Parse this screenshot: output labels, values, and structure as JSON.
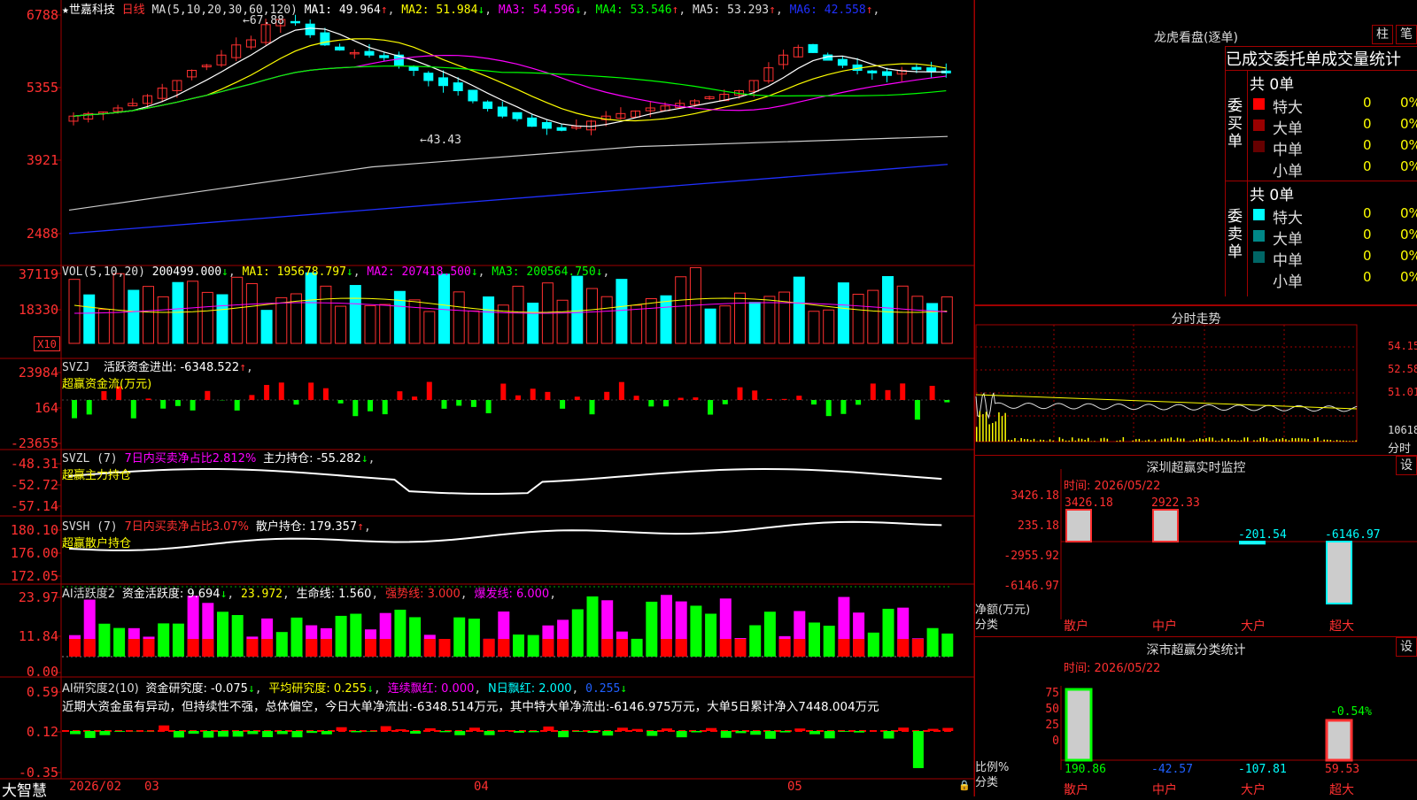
{
  "stock": {
    "name": "世嘉科技",
    "period": "日线",
    "star": "★"
  },
  "main": {
    "ma_label": "MA(5,10,20,30,60,120)",
    "ma": [
      {
        "label": "MA1: 49.964",
        "arrow": "↑",
        "color": "#ffffff"
      },
      {
        "label": "MA2: 51.984",
        "arrow": "↓",
        "color": "#ffff00"
      },
      {
        "label": "MA3: 54.596",
        "arrow": "↓",
        "color": "#ff00ff"
      },
      {
        "label": "MA4: 53.546",
        "arrow": "↑",
        "color": "#00ff00"
      },
      {
        "label": "MA5: 53.293",
        "arrow": "↑",
        "color": "#dddddd"
      },
      {
        "label": "MA6: 42.558",
        "arrow": "↑",
        "color": "#2030ff"
      }
    ],
    "yticks": [
      "6788",
      "5355",
      "3921",
      "2488"
    ],
    "high_marker": "67.88",
    "low_marker": "43.43"
  },
  "vol": {
    "title": "VOL(5,10,20)",
    "value": "200499.000",
    "ma": [
      {
        "label": "MA1: 195678.797",
        "color": "#ffff00"
      },
      {
        "label": "MA2: 207418.500",
        "color": "#ff00ff"
      },
      {
        "label": "MA3: 200564.750",
        "color": "#00ff00"
      }
    ],
    "yticks": [
      "37119",
      "18330"
    ],
    "unit": "X10"
  },
  "svzj": {
    "title": "SVZJ",
    "text": "活跃资金进出: -6348.522",
    "subtitle": "超赢资金流(万元)",
    "yticks": [
      "23984",
      "164",
      "-23655"
    ]
  },
  "svzl": {
    "title": "SVZL (7)",
    "text1": "7日内买卖净占比2.812%",
    "text2": "主力持仓: -55.282",
    "subtitle": "超赢主力持仓",
    "yticks": [
      "-48.31",
      "-52.72",
      "-57.14"
    ]
  },
  "svsh": {
    "title": "SVSH (7)",
    "text1": "7日内买卖净占比3.07%",
    "text2": "散户持仓: 179.357",
    "subtitle": "超赢散户持仓",
    "yticks": [
      "180.10",
      "176.00",
      "172.05"
    ]
  },
  "ai1": {
    "title": "AI活跃度2",
    "t1": "资金活跃度: 9.694",
    "t2": "23.972",
    "t3": "生命线: 1.560",
    "t4": "强势线: 3.000",
    "t5": "爆发线: 6.000",
    "yticks": [
      "23.97",
      "11.84",
      "0.00"
    ]
  },
  "ai2": {
    "title": "AI研究度2(10)",
    "t1": "资金研究度: -0.075",
    "t2": "平均研究度: 0.255",
    "t3": "连续飘红: 0.000",
    "t4": "N日飘红: 2.000",
    "t5": "0.255",
    "comment": "近期大资金虽有异动，但持续性不强，总体偏空，今日大单净流出:-6348.514万元，其中特大单净流出:-6146.975万元，大单5日累计净入7448.004万元",
    "yticks": [
      "0.59",
      "0.12",
      "-0.35"
    ]
  },
  "xaxis": {
    "brand": "大智慧",
    "labels": [
      "2026/02",
      "03",
      "04",
      "05"
    ]
  },
  "lhb": {
    "title": "龙虎看盘(逐单)",
    "btn1": "柱",
    "btn2": "笔",
    "header": "已成交委托单成交量统计",
    "buy": {
      "side": "委买单",
      "total": "共 0单",
      "rows": [
        {
          "label": "特大",
          "v1": "0",
          "v2": "0%",
          "color": "#ff0000"
        },
        {
          "label": "大单",
          "v1": "0",
          "v2": "0%",
          "color": "#990000"
        },
        {
          "label": "中单",
          "v1": "0",
          "v2": "0%",
          "color": "#660000"
        },
        {
          "label": "小单",
          "v1": "0",
          "v2": "0%",
          "color": "#000000"
        }
      ]
    },
    "sell": {
      "side": "委卖单",
      "total": "共 0单",
      "rows": [
        {
          "label": "特大",
          "v1": "0",
          "v2": "0%",
          "color": "#00ffff"
        },
        {
          "label": "大单",
          "v1": "0",
          "v2": "0%",
          "color": "#008888"
        },
        {
          "label": "中单",
          "v1": "0",
          "v2": "0%",
          "color": "#006666"
        },
        {
          "label": "小单",
          "v1": "0",
          "v2": "0%",
          "color": "#000000"
        }
      ]
    }
  },
  "fs": {
    "title": "分时走势",
    "yticks": [
      "54.15",
      "52.58",
      "51.01"
    ],
    "vol": "10618",
    "label": "分时"
  },
  "szjk": {
    "title": "深圳超赢实时监控",
    "btn": "设",
    "time": "时间: 2026/05/22",
    "yticks": [
      "3426.18",
      "235.18",
      "-2955.92",
      "-6146.97"
    ],
    "ylabel": "净额(万元)",
    "xlabel": "分类",
    "bars": [
      {
        "cat": "散户",
        "value": 3426.18,
        "label": "3426.18"
      },
      {
        "cat": "中户",
        "value": 2922.33,
        "label": "2922.33"
      },
      {
        "cat": "大户",
        "value": -201.54,
        "label": "-201.54"
      },
      {
        "cat": "超大",
        "value": -6146.97,
        "label": "-6146.97"
      }
    ]
  },
  "szfl": {
    "title": "深市超赢分类统计",
    "btn": "设",
    "time": "时间: 2026/05/22",
    "yticks": [
      "75",
      "50",
      "25",
      "0"
    ],
    "ylabel": "比例%",
    "xlabel": "分类",
    "bars": [
      {
        "cat": "散户",
        "value": 190.86,
        "label": "190.86"
      },
      {
        "cat": "中户",
        "value": -42.57,
        "label": "-42.57"
      },
      {
        "cat": "大户",
        "value": -107.81,
        "label": "-107.81"
      },
      {
        "cat": "超大",
        "value": 59.53,
        "label": "59.53"
      }
    ],
    "bar_top_label": "-0.54%"
  },
  "colors": {
    "up": "#ff3030",
    "down": "#00ffff",
    "grid": "#a00000",
    "vol_up": "#ff3030",
    "vol_down": "#00ffff"
  }
}
